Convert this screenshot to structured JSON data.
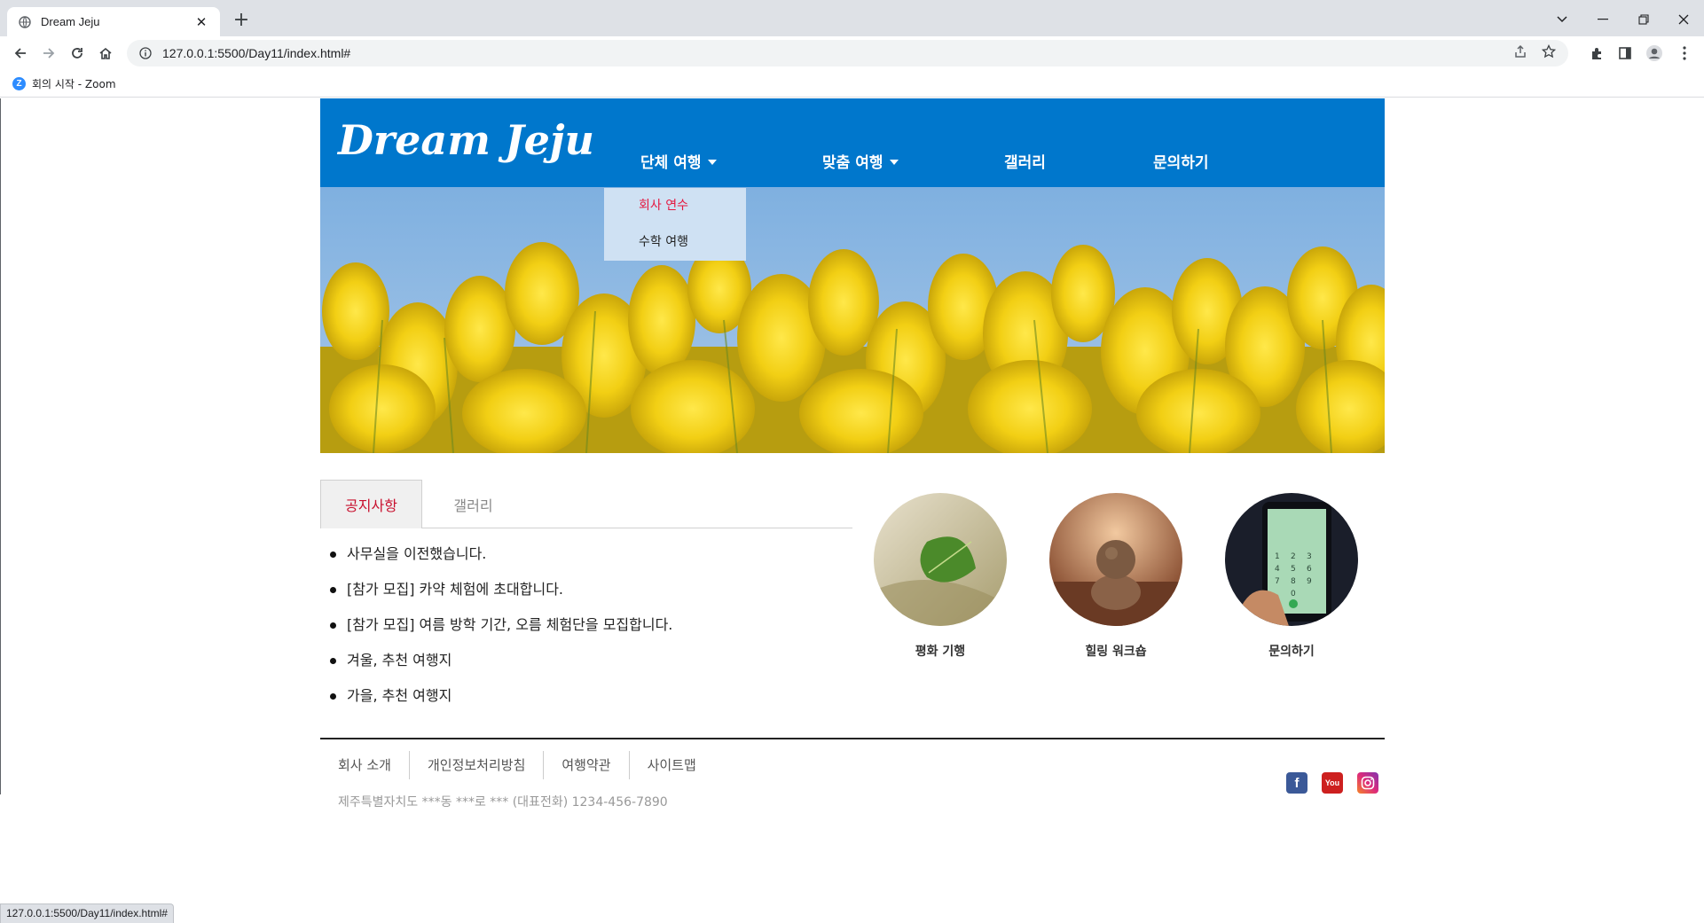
{
  "browser": {
    "tab_title": "Dream Jeju",
    "url": "127.0.0.1:5500/Day11/index.html#",
    "bookmark_label": "회의 시작 - Zoom",
    "status_url": "127.0.0.1:5500/Day11/index.html#"
  },
  "site": {
    "logo": "Dream Jeju",
    "menu": [
      {
        "label": "단체 여행",
        "has_caret": true
      },
      {
        "label": "맞춤 여행",
        "has_caret": true
      },
      {
        "label": "갤러리",
        "has_caret": false
      },
      {
        "label": "문의하기",
        "has_caret": false
      }
    ],
    "dropdown": [
      {
        "label": "회사 연수",
        "active": true
      },
      {
        "label": "수학 여행",
        "active": false
      }
    ],
    "tabs": {
      "notice": "공지사항",
      "gallery": "갤러리"
    },
    "notices": [
      "사무실을 이전했습니다.",
      "[참가 모집] 카약 체험에 초대합니다.",
      "[참가 모집] 여름 방학 기간, 오름 체험단을 모집합니다.",
      "겨울, 추천 여행지",
      "가을, 추천 여행지"
    ],
    "circles": [
      {
        "label": "평화 기행"
      },
      {
        "label": "힐링 워크숍"
      },
      {
        "label": "문의하기"
      }
    ],
    "footer": {
      "links": [
        "회사 소개",
        "개인정보처리방침",
        "여행약관",
        "사이트맵"
      ],
      "address": "제주특별자치도 ***동 ***로 *** (대표전화) 1234-456-7890",
      "social": [
        {
          "icon": "facebook-icon",
          "glyph": "f",
          "color": "#3b5998"
        },
        {
          "icon": "youtube-icon",
          "glyph": "You",
          "color": "#cd201f"
        },
        {
          "icon": "instagram-icon",
          "glyph": "◎",
          "color": "#c13584"
        }
      ]
    }
  },
  "colors": {
    "header_blue": "#0077cc",
    "dropdown_bg": "#cfe1f3",
    "active_red": "#e5173f",
    "tab_red": "#c8102e"
  }
}
